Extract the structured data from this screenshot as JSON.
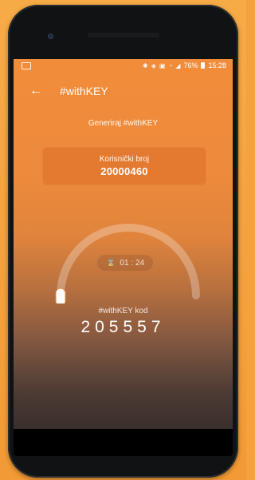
{
  "status_bar": {
    "icons": [
      "bluetooth-icon",
      "mute-icon",
      "nfc-icon",
      "wifi-icon",
      "signal-icon"
    ],
    "battery": "76%",
    "time": "15:28"
  },
  "app_bar": {
    "back_icon": "arrow-left-icon",
    "title": "#withKEY"
  },
  "subtitle": "Generiraj #withKEY",
  "user_card": {
    "label": "Korisnički broj",
    "value": "20000460"
  },
  "timer": {
    "icon": "hourglass-icon",
    "value": "01 : 24"
  },
  "code_section": {
    "label": "#withKEY kod",
    "code": "205557"
  },
  "colors": {
    "accent": "#F08C3A",
    "dark": "#3A2F2C"
  }
}
